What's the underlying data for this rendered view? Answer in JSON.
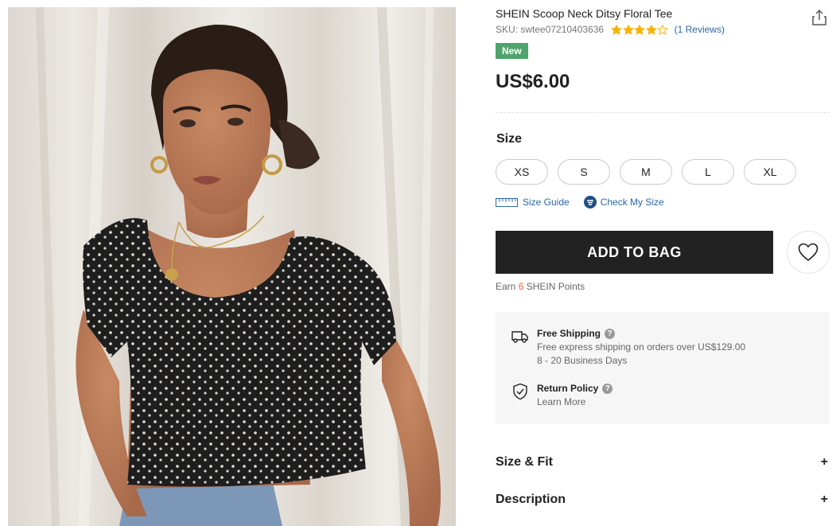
{
  "product": {
    "title": "SHEIN Scoop Neck Ditsy Floral Tee",
    "sku_label": "SKU: swtee07210403636",
    "rating": 4,
    "rating_max": 5,
    "reviews_label": "(1 Reviews)",
    "badge": "New",
    "price": "US$6.00"
  },
  "size": {
    "label": "Size",
    "options": [
      "XS",
      "S",
      "M",
      "L",
      "XL"
    ],
    "guide_label": "Size Guide",
    "check_label": "Check My Size"
  },
  "actions": {
    "add_to_bag": "ADD TO BAG"
  },
  "points": {
    "prefix": "Earn",
    "count": "6",
    "suffix": "SHEIN Points"
  },
  "shipping": {
    "title": "Free Shipping",
    "line1": "Free express shipping on orders over US$129.00",
    "line2": "8 - 20 Business Days",
    "return_title": "Return Policy",
    "return_link": "Learn More",
    "help_glyph": "?"
  },
  "accordion": {
    "fit": "Size & Fit",
    "description": "Description",
    "expand_glyph": "+"
  },
  "icons": {
    "share": "share-icon",
    "wishlist": "heart-icon",
    "ruler": "ruler-icon",
    "check_size": "hanger-icon",
    "truck": "truck-icon",
    "shield": "shield-check-icon"
  },
  "colors": {
    "badge_green": "#4fa36c",
    "star_gold": "#f8b200",
    "link_blue": "#2d68a8",
    "points_orange": "#fa6338",
    "button_black": "#222222"
  }
}
